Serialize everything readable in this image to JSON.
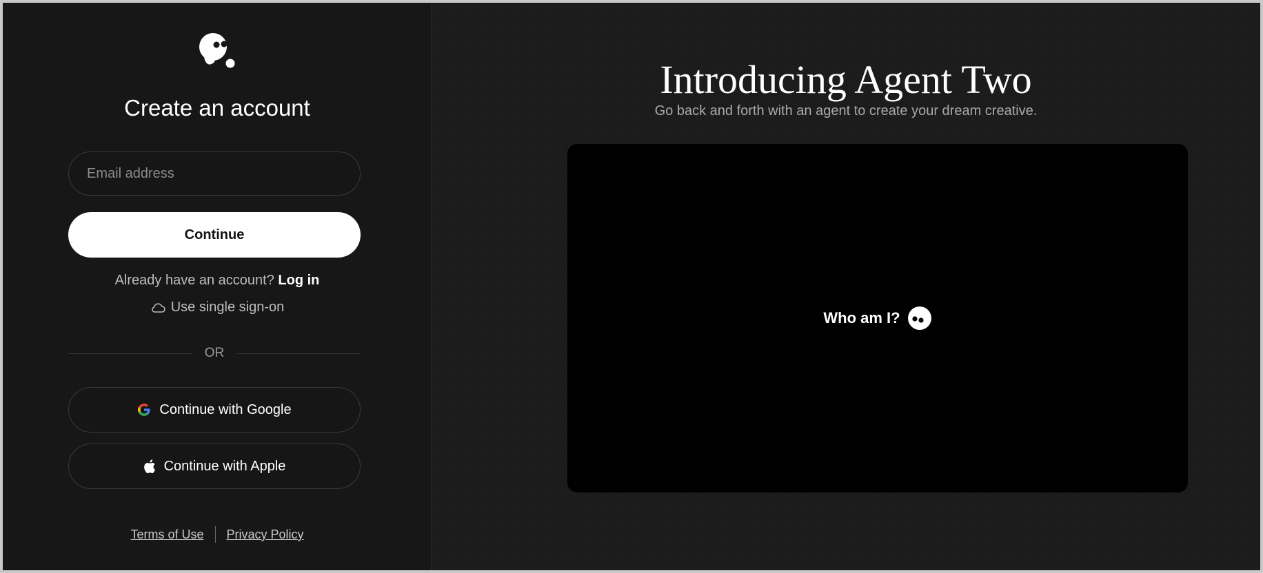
{
  "left_panel": {
    "title": "Create an account",
    "email_placeholder": "Email address",
    "continue_label": "Continue",
    "login_prompt": "Already have an account?",
    "login_link": "Log in",
    "sso_label": "Use single sign-on",
    "or_label": "OR",
    "google_label": "Continue with Google",
    "apple_label": "Continue with Apple",
    "terms_label": "Terms of Use",
    "privacy_label": "Privacy Policy"
  },
  "right_panel": {
    "title": "Introducing Agent Two",
    "subtitle": "Go back and forth with an agent to create your dream creative.",
    "video_caption": "Who am I?"
  },
  "icons": {
    "logo": "logo-icon",
    "sso": "cloud-icon",
    "google": "google-icon",
    "apple": "apple-icon",
    "video_mascot": "mascot-icon"
  },
  "colors": {
    "background": "#171717",
    "panel_right": "#1c1c1c",
    "primary_button": "#ffffff",
    "text": "#ffffff",
    "muted_text": "#bdbdbd"
  }
}
